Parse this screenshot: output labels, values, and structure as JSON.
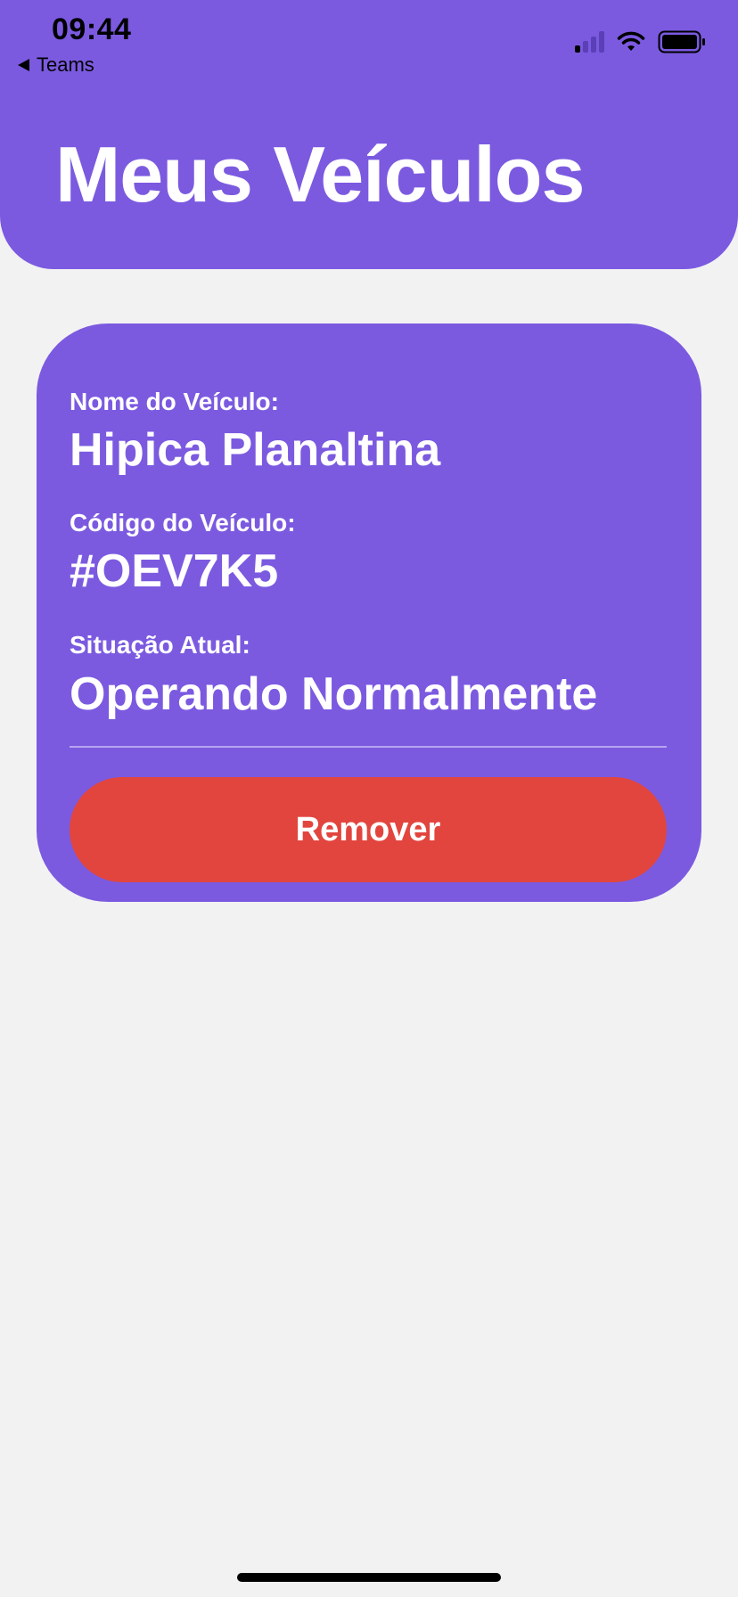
{
  "status_bar": {
    "time": "09:44",
    "back_label": "Teams",
    "back_icon": "back-triangle-icon",
    "cellular_icon": "cellular-signal-icon",
    "wifi_icon": "wifi-icon",
    "battery_icon": "battery-icon"
  },
  "header": {
    "title": "Meus Veículos",
    "color": "#7b5ae0"
  },
  "vehicle_card": {
    "name_label": "Nome do Veículo:",
    "name_value": "Hipica Planaltina",
    "code_label": "Código do Veículo:",
    "code_value": "#OEV7K5",
    "status_label": "Situação Atual:",
    "status_value": "Operando Normalmente",
    "remove_label": "Remover",
    "remove_color": "#e2453e"
  }
}
